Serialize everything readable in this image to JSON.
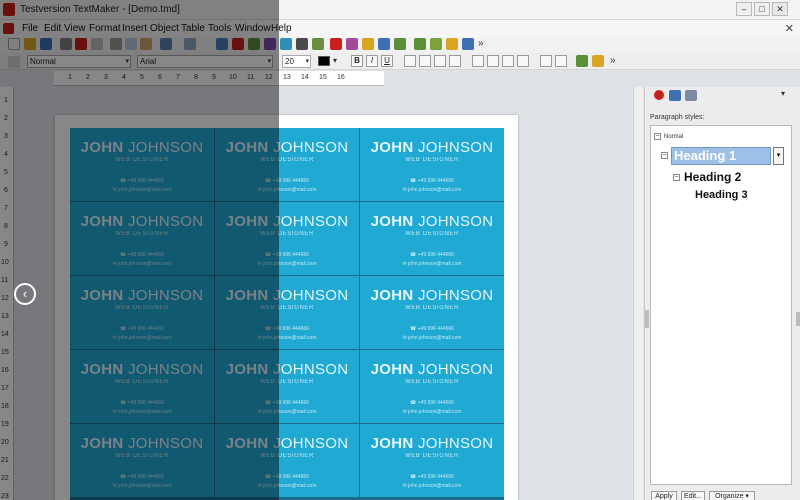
{
  "window": {
    "title": "Testversion TextMaker - [Demo.tmd]",
    "controls": {
      "minimize": "–",
      "maximize": "□",
      "close": "✕"
    }
  },
  "menubar": {
    "items": [
      "File",
      "Edit",
      "View",
      "Format",
      "Insert",
      "Object",
      "Table",
      "Tools",
      "Window",
      "Help"
    ],
    "close_glyph": "✕"
  },
  "toolbar": {
    "more_glyph": "»",
    "icon_colors": [
      "#c8201c",
      "#d9a623",
      "#3d6fb5",
      "#5c8f3a",
      "#7b4aa8",
      "#2f8fb8"
    ]
  },
  "format_bar": {
    "paragraph_style": "Normal",
    "font_name": "Arial",
    "font_size": "20",
    "font_color": "#000000",
    "bold_glyph": "B",
    "italic_glyph": "I",
    "underline_glyph": "U",
    "dropdown_glyph": "▾",
    "more_glyph": "»"
  },
  "ruler": {
    "numbers": [
      "1",
      "2",
      "3",
      "4",
      "5",
      "6",
      "7",
      "8",
      "9",
      "10",
      "11",
      "12",
      "13",
      "14",
      "15",
      "16"
    ],
    "vertical_numbers": [
      "1",
      "2",
      "3",
      "4",
      "5",
      "6",
      "7",
      "8",
      "9",
      "10",
      "11",
      "12",
      "13",
      "14",
      "15",
      "16",
      "17",
      "18",
      "19",
      "20",
      "21",
      "22",
      "23"
    ]
  },
  "card": {
    "first_name": "JOHN",
    "last_name": "JOHNSON",
    "role": "WEB DESIGNER",
    "phone": "☎ +49 996 444666",
    "email": "✉ john.johnson@mail.com",
    "background": "#1fa9d3"
  },
  "cards_visible_rows": 5,
  "cards_columns": 3,
  "navigation": {
    "prev_glyph": "‹"
  },
  "panel": {
    "title": "Paragraph styles:",
    "styles": {
      "normal": "Normal",
      "heading1": "Heading 1",
      "heading2": "Heading 2",
      "heading3": "Heading 3"
    },
    "expand_glyph": "−",
    "dropdown_glyph": "▾",
    "buttons": {
      "apply": "Apply",
      "edit": "Edit...",
      "organize": "Organize ▾"
    }
  }
}
